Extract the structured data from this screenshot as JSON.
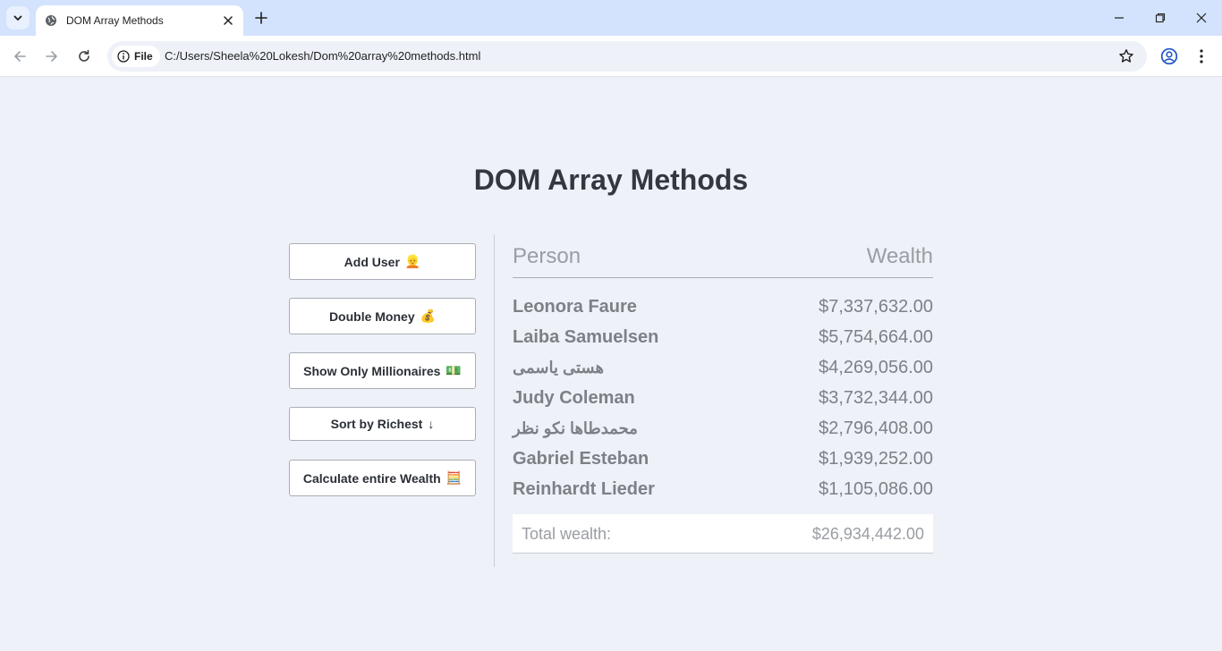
{
  "browser": {
    "tab_title": "DOM Array Methods",
    "site_chip_label": "File",
    "url": "C:/Users/Sheela%20Lokesh/Dom%20array%20methods.html"
  },
  "page": {
    "title": "DOM Array Methods"
  },
  "actions": [
    {
      "label": "Add User",
      "emoji": "👱"
    },
    {
      "label": "Double Money",
      "emoji": "💰"
    },
    {
      "label": "Show Only Millionaires",
      "emoji": "💵"
    },
    {
      "label": "Sort by Richest",
      "emoji": "↓"
    },
    {
      "label": "Calculate entire Wealth",
      "emoji": "🧮"
    }
  ],
  "table": {
    "header_person": "Person",
    "header_wealth": "Wealth",
    "rows": [
      {
        "name": "Leonora Faure",
        "wealth": "$7,337,632.00"
      },
      {
        "name": "Laiba Samuelsen",
        "wealth": "$5,754,664.00"
      },
      {
        "name": "هستی یاسمی",
        "wealth": "$4,269,056.00"
      },
      {
        "name": "Judy Coleman",
        "wealth": "$3,732,344.00"
      },
      {
        "name": "محمدطاها نكو نظر",
        "wealth": "$2,796,408.00"
      },
      {
        "name": "Gabriel Esteban",
        "wealth": "$1,939,252.00"
      },
      {
        "name": "Reinhardt Lieder",
        "wealth": "$1,105,086.00"
      }
    ],
    "total_label": "Total wealth:",
    "total_value": "$26,934,442.00"
  }
}
